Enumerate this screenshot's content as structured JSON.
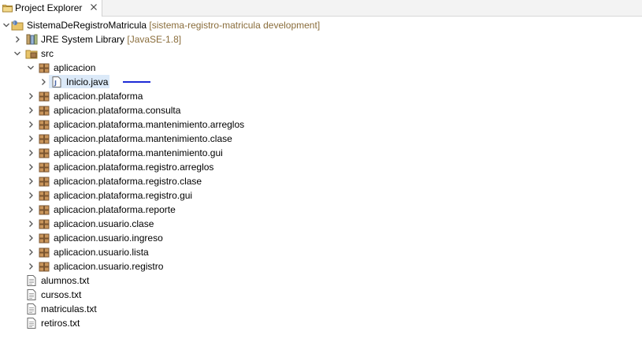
{
  "tab": {
    "title": "Project Explorer"
  },
  "project": {
    "name": "SistemaDeRegistroMatricula",
    "decoration": "[sistema-registro-matricula development]"
  },
  "jre": {
    "name": "JRE System Library",
    "decoration": "[JavaSE-1.8]"
  },
  "src": {
    "name": "src"
  },
  "packages": [
    "aplicacion",
    "aplicacion.plataforma",
    "aplicacion.plataforma.consulta",
    "aplicacion.plataforma.mantenimiento.arreglos",
    "aplicacion.plataforma.mantenimiento.clase",
    "aplicacion.plataforma.mantenimiento.gui",
    "aplicacion.plataforma.registro.arreglos",
    "aplicacion.plataforma.registro.clase",
    "aplicacion.plataforma.registro.gui",
    "aplicacion.plataforma.reporte",
    "aplicacion.usuario.clase",
    "aplicacion.usuario.ingreso",
    "aplicacion.usuario.lista",
    "aplicacion.usuario.registro"
  ],
  "file_in_package": {
    "name": "Inicio.java"
  },
  "files": [
    "alumnos.txt",
    "cursos.txt",
    "matriculas.txt",
    "retiros.txt"
  ],
  "colors": {
    "selection": "#dbe9f8",
    "decoration": "#8a6d3b",
    "annotation_line": "#1e2bd6"
  }
}
